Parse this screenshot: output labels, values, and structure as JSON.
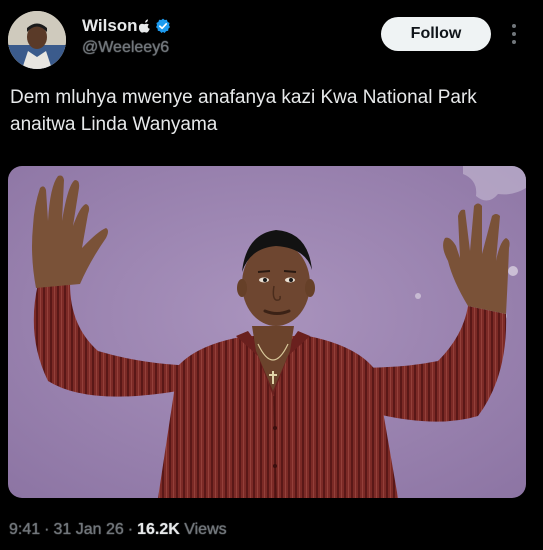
{
  "author": {
    "display_name": "Wilson",
    "handle": "@Weeleey6",
    "avatar_icon": "avatar-photo",
    "badge_icons": [
      "apple-icon",
      "verified-icon"
    ],
    "verified_color": "#1d9bf0"
  },
  "actions": {
    "follow_label": "Follow",
    "more_icon": "more-vertical-icon"
  },
  "tweet": {
    "text": "Dem mluhya mwenye anafanya kazi Kwa National Park anaitwa Linda Wanyama"
  },
  "meta": {
    "time": "9:41",
    "date": "31 Jan 26",
    "views_count": "16.2K",
    "views_label": "Views",
    "separator": "·"
  },
  "colors": {
    "background": "#000000",
    "text_primary": "#e7e9ea",
    "text_secondary": "#71767b",
    "follow_bg": "#eff3f4",
    "follow_text": "#0f1419",
    "wall": "#9f86b4"
  }
}
